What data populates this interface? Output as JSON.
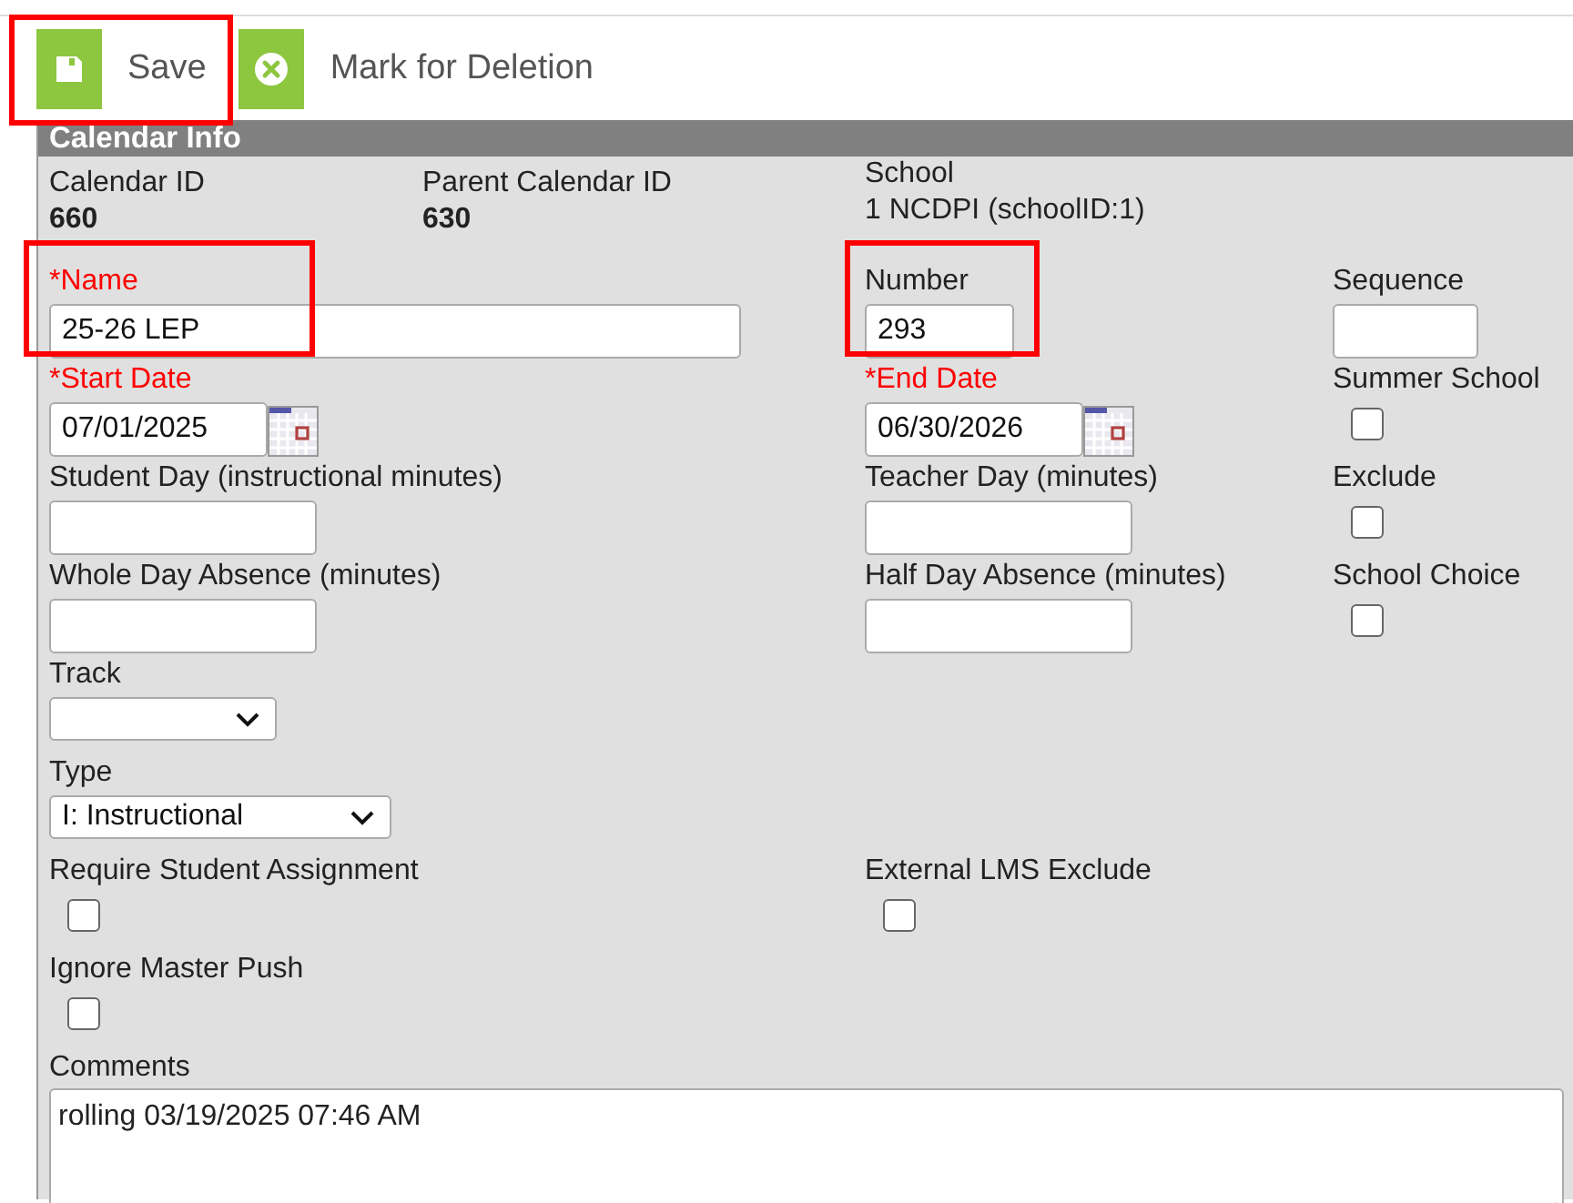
{
  "toolbar": [
    {
      "kind": "save",
      "label": "Save",
      "highlighted": true
    },
    {
      "kind": "delete",
      "label": "Mark for Deletion",
      "highlighted": false
    }
  ],
  "section": {
    "title": "Calendar Info"
  },
  "rows": [
    {
      "left": [
        {
          "kind": "readout",
          "label": "Calendar ID",
          "value": "660"
        },
        {
          "kind": "readout",
          "label": "Parent Calendar ID",
          "value": "630"
        }
      ],
      "middle": [
        {
          "kind": "plain_readout",
          "label": "School",
          "value": "1 NCDPI (schoolID:1)"
        }
      ],
      "right": []
    },
    {
      "left": [
        {
          "kind": "text_wide",
          "label": "*Name",
          "value": "25-26 LEP",
          "required": true,
          "highlighted": true
        }
      ],
      "middle": [
        {
          "kind": "text_short",
          "label": "Number",
          "value": "293",
          "required": false,
          "highlighted": true
        }
      ],
      "right": [
        {
          "kind": "text_short",
          "label": "Sequence",
          "required": false,
          "highlighted": false
        }
      ]
    },
    {
      "left": [
        {
          "kind": "date",
          "label": "*Start Date",
          "value": "07/01/2025",
          "required": true
        }
      ],
      "middle": [
        {
          "kind": "date",
          "label": "*End Date",
          "value": "06/30/2026",
          "required": true
        }
      ],
      "right": [
        {
          "kind": "checkbox",
          "label": "Summer School",
          "checked": false
        }
      ]
    },
    {
      "left": [
        {
          "kind": "text",
          "label": "Student Day (instructional minutes)",
          "required": false,
          "highlighted": false
        }
      ],
      "middle": [
        {
          "kind": "text",
          "label": "Teacher Day (minutes)",
          "required": false,
          "highlighted": false
        }
      ],
      "right": [
        {
          "kind": "checkbox",
          "label": "Exclude",
          "checked": false
        }
      ]
    },
    {
      "left": [
        {
          "kind": "text",
          "label": "Whole Day Absence (minutes)",
          "required": false,
          "highlighted": false
        }
      ],
      "middle": [
        {
          "kind": "text",
          "label": "Half Day Absence (minutes)",
          "required": false,
          "highlighted": false
        }
      ],
      "right": [
        {
          "kind": "checkbox",
          "label": "School Choice",
          "checked": false
        }
      ]
    },
    {
      "left": [
        {
          "kind": "select",
          "label": "Track"
        }
      ],
      "middle": [],
      "right": []
    },
    {
      "left": [
        {
          "kind": "select_wide",
          "label": "Type",
          "value": "I: Instructional"
        }
      ],
      "middle": [],
      "right": []
    },
    {
      "left": [
        {
          "kind": "checkbox",
          "label": "Require Student Assignment",
          "checked": false
        }
      ],
      "middle": [
        {
          "kind": "checkbox",
          "label": "External LMS Exclude",
          "checked": false
        }
      ],
      "right": []
    },
    {
      "left": [
        {
          "kind": "checkbox",
          "label": "Ignore Master Push",
          "checked": false
        }
      ],
      "middle": [],
      "right": []
    }
  ],
  "comments": {
    "label": "Comments",
    "value": "rolling 03/19/2025 07:46 AM"
  }
}
